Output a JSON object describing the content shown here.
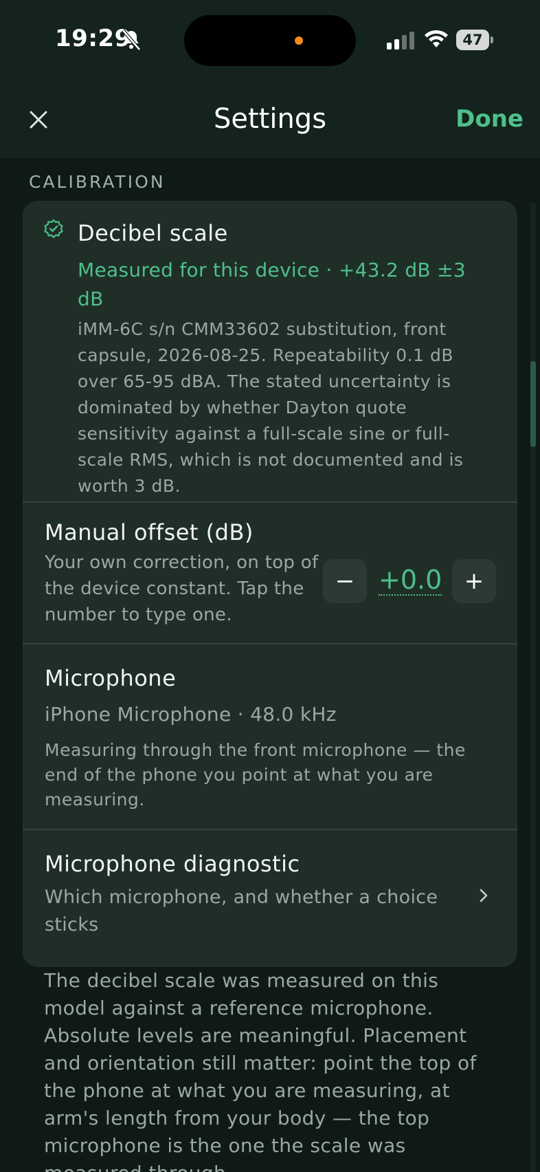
{
  "status_bar": {
    "time": "19:29",
    "battery": "47"
  },
  "nav": {
    "title": "Settings",
    "done_label": "Done"
  },
  "section": {
    "header": "CALIBRATION"
  },
  "decibel_scale": {
    "title": "Decibel scale",
    "status_line1": "Measured for this device  ·  +43.2 dB ±3",
    "status_line2": "dB",
    "details": [
      "iMM-6C s/n CMM33602 substitution, front",
      "capsule, 2026-08-25. Repeatability 0.1 dB",
      "over 65-95 dBA. The stated uncertainty is",
      "dominated by whether Dayton quote",
      "sensitivity against a full-scale sine or full-",
      "scale RMS, which is not documented and is",
      "worth 3 dB."
    ]
  },
  "manual_offset": {
    "title": "Manual offset (dB)",
    "description": [
      "Your own correction, on top of",
      "the device constant. Tap the",
      "number to type one."
    ],
    "decrement_label": "−",
    "value": "+0.0",
    "increment_label": "+"
  },
  "microphone": {
    "title": "Microphone",
    "info": "iPhone Microphone  ·  48.0 kHz",
    "description": [
      "Measuring through the front microphone — the",
      "end of the phone you point at what you are",
      "measuring."
    ]
  },
  "diagnostic": {
    "title": "Microphone diagnostic",
    "description": [
      "Which microphone, and whether a choice",
      "sticks"
    ]
  },
  "footer": [
    "The decibel scale was measured on this",
    "model against a reference microphone.",
    "Absolute levels are meaningful. Placement",
    "and orientation still matter: point the top of",
    "the phone at what you are measuring, at",
    "arm's length from your body — the top",
    "microphone is the one the scale was",
    "measured through."
  ],
  "colors": {
    "accent": "#4fbf8a",
    "background": "#0f1a16",
    "card": "#1f2f28"
  }
}
